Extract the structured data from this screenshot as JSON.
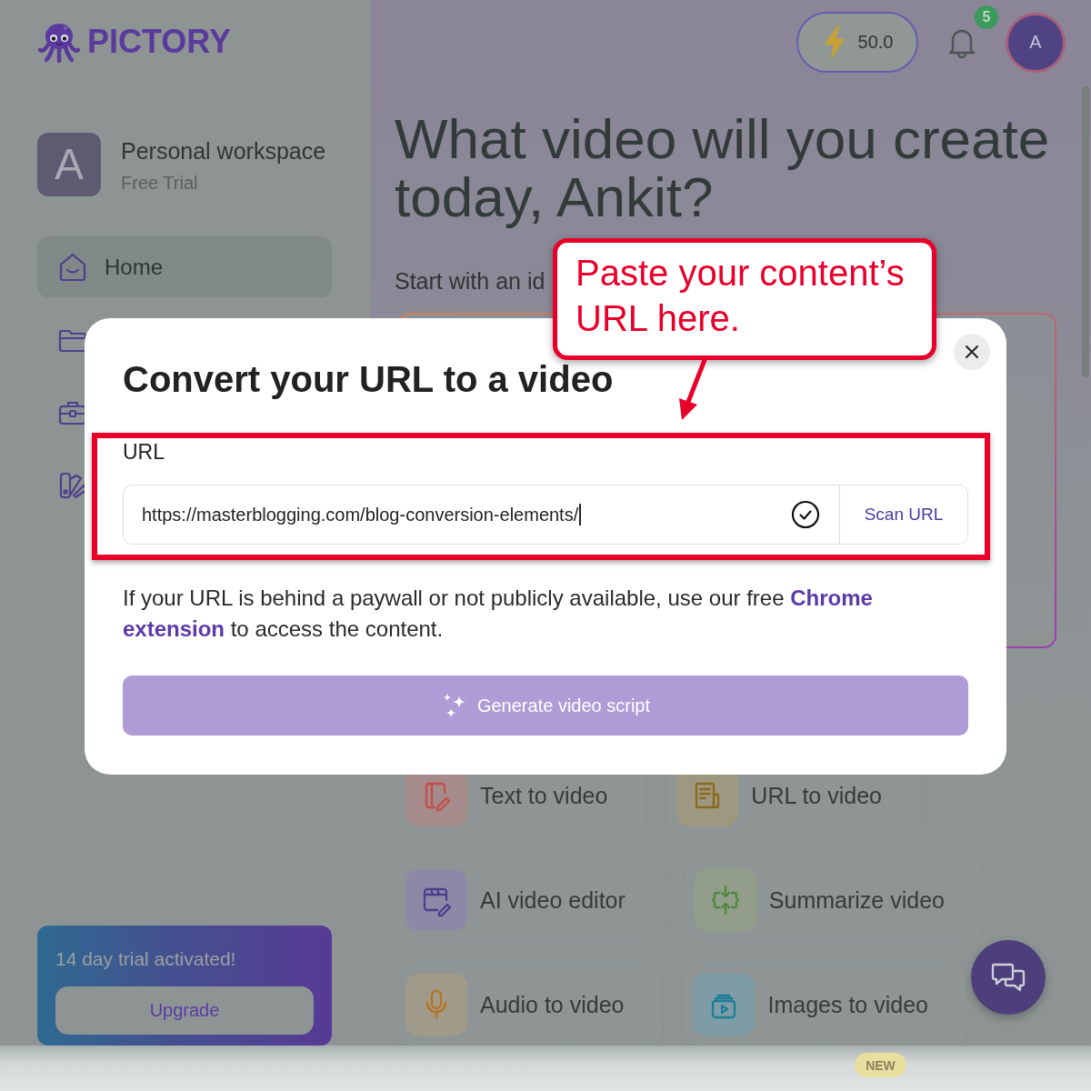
{
  "logo": {
    "text": "PICTORY"
  },
  "header": {
    "credits": {
      "value": "50.0"
    },
    "notifications": {
      "count": "5"
    },
    "avatar": {
      "initial": "A"
    }
  },
  "sidebar": {
    "workspace": {
      "initial": "A",
      "name": "Personal workspace",
      "plan": "Free Trial"
    },
    "items": [
      {
        "kind": "home",
        "label": "Home",
        "selected": true
      },
      {
        "kind": "folder",
        "selected": false
      },
      {
        "kind": "briefcase",
        "selected": false
      },
      {
        "kind": "swatches",
        "selected": false
      }
    ],
    "trial_card": {
      "message": "14 day trial activated!",
      "button": "Upgrade"
    }
  },
  "main": {
    "heading": "What video will you create today, Ankit?",
    "subheading": "Start with an id",
    "tools": [
      {
        "kind": "text",
        "label": "Text to video"
      },
      {
        "kind": "url",
        "label": "URL to video"
      },
      {
        "kind": "editor",
        "label": "AI video editor"
      },
      {
        "kind": "summarize",
        "label": "Summarize video"
      },
      {
        "kind": "audio",
        "label": "Audio to video"
      },
      {
        "kind": "images",
        "label": "Images to video"
      }
    ],
    "new_badge": "NEW"
  },
  "modal": {
    "title": "Convert your URL to a video",
    "url_field": {
      "label": "URL",
      "value": "https://masterblogging.com/blog-conversion-elements/",
      "focused": true,
      "valid": true
    },
    "scan_button": "Scan URL",
    "note": "If your URL is behind a paywall or not publicly available, use our free **Chrome extension** to access the content.",
    "generate_button": {
      "label": "Generate video script",
      "disabled": true
    }
  },
  "annotation": {
    "text": "Paste your content’s URL here."
  }
}
